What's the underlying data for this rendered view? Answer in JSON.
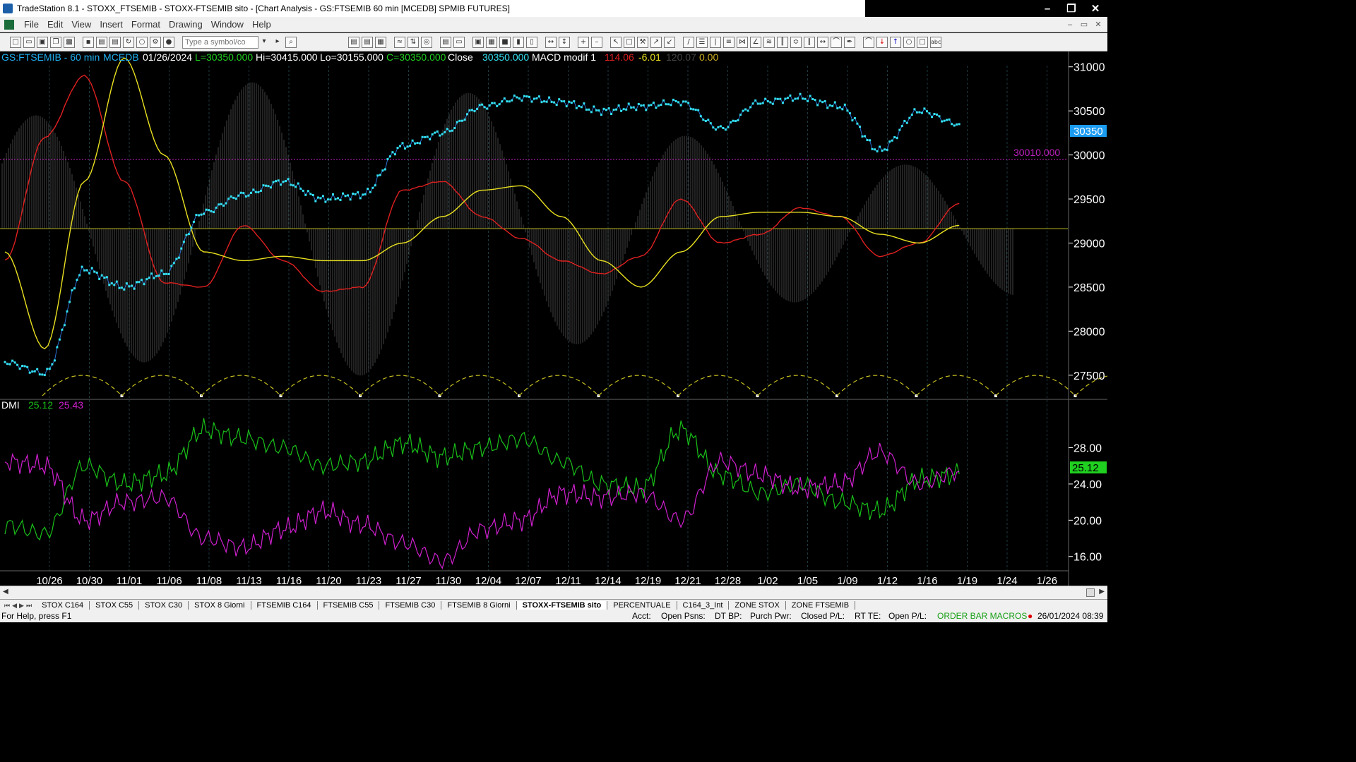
{
  "window": {
    "title": "TradeStation 8.1 - STOXX_FTSEMIB - STOXX-FTSEMIB sito - [Chart Analysis - GS:FTSEMIB  60 min  [MCEDB] SPMIB FUTURES]"
  },
  "menu": [
    "File",
    "Edit",
    "View",
    "Insert",
    "Format",
    "Drawing",
    "Window",
    "Help"
  ],
  "toolbar": {
    "symbol_placeholder": "Type a symbol/co"
  },
  "price_header": {
    "symbol": "GS:FTSEMIB - 60 min",
    "source": "MCEDB",
    "date": "01/26/2024",
    "last": "L=30350.000",
    "high": "Hi=30415.000",
    "low": "Lo=30155.000",
    "close": "C=30350.000",
    "close_label": "Close",
    "close_value": "30350.000",
    "indicator": "MACD modif 1",
    "ind_v1": "114.06",
    "ind_v2": "-6.01",
    "ind_v3": "120.07",
    "ind_v4": "0.00"
  },
  "price_axis": {
    "ticks": [
      "31000",
      "30500",
      "30000",
      "29500",
      "29000",
      "28500",
      "28000",
      "27500"
    ],
    "current_price": "30350",
    "reference_level": "30010.000"
  },
  "dmi_header": {
    "name": "DMI",
    "plus": "25.12",
    "minus": "25.43"
  },
  "dmi_axis": {
    "ticks": [
      "28.00",
      "24.00",
      "20.00",
      "16.00"
    ],
    "current": "25.12"
  },
  "time_axis": [
    "10/26",
    "10/30",
    "11/01",
    "11/06",
    "11/08",
    "11/13",
    "11/16",
    "11/20",
    "11/23",
    "11/27",
    "11/30",
    "12/04",
    "12/07",
    "12/11",
    "12/14",
    "12/19",
    "12/21",
    "12/28",
    "1/02",
    "1/05",
    "1/09",
    "1/12",
    "1/16",
    "1/19",
    "1/24",
    "1/26"
  ],
  "colors": {
    "price": "#33e0f0",
    "red_line": "#e02020",
    "yellow_line": "#e8e020",
    "histogram": "#7a7a7a",
    "dmi_plus": "#19c019",
    "dmi_minus": "#d020d0",
    "ref_level": "#c020c0"
  },
  "chart_data": [
    {
      "type": "line",
      "x": [
        "10/26",
        "10/30",
        "11/01",
        "11/06",
        "11/08",
        "11/13",
        "11/16",
        "11/20",
        "11/23",
        "11/27",
        "11/30",
        "12/04",
        "12/07",
        "12/11",
        "12/14",
        "12/19",
        "12/21",
        "12/28",
        "1/02",
        "1/05",
        "1/09",
        "1/12",
        "1/16",
        "1/19",
        "1/24"
      ],
      "ylim": [
        27250,
        31150
      ],
      "series": [
        {
          "values": [
            27650,
            27520,
            28700,
            28500,
            28650,
            29350,
            29550,
            29700,
            29500,
            29550,
            30100,
            30250,
            30550,
            30650,
            30600,
            30500,
            30550,
            30600,
            30300,
            30600,
            30650,
            30550,
            30050,
            30500,
            30350
          ]
        },
        {
          "values": [
            28800,
            30200,
            30900,
            29700,
            28550,
            28500,
            29200,
            28800,
            28450,
            28500,
            29600,
            29700,
            29300,
            29050,
            28800,
            28650,
            28850,
            29500,
            29000,
            29100,
            29400,
            29300,
            28850,
            29000,
            29450
          ]
        },
        {
          "values": [
            28900,
            27800,
            29700,
            31100,
            30000,
            28900,
            28800,
            28850,
            28800,
            28800,
            29000,
            29300,
            29600,
            29650,
            29300,
            28800,
            28500,
            28900,
            29300,
            29350,
            29350,
            29300,
            29100,
            29000,
            29200
          ]
        }
      ]
    },
    {
      "type": "line",
      "x": [
        "10/26",
        "10/30",
        "11/01",
        "11/06",
        "11/08",
        "11/13",
        "11/16",
        "11/20",
        "11/23",
        "11/27",
        "11/30",
        "12/04",
        "12/07",
        "12/11",
        "12/14",
        "12/19",
        "12/21",
        "12/28",
        "1/02",
        "1/05",
        "1/09",
        "1/12",
        "1/16",
        "1/19",
        "1/24"
      ],
      "ylim": [
        14.5,
        31
      ],
      "series": [
        {
          "name": "DMI+",
          "values": [
            19.5,
            18.5,
            26.0,
            24.0,
            25.0,
            30.0,
            29.0,
            28.0,
            26.0,
            26.5,
            28.5,
            27.0,
            28.0,
            29.0,
            26.5,
            24.0,
            23.5,
            30.0,
            25.0,
            23.0,
            24.0,
            22.0,
            21.0,
            24.5,
            25.1
          ]
        },
        {
          "name": "DMI-",
          "values": [
            26.5,
            26.0,
            20.0,
            22.0,
            22.5,
            18.0,
            17.0,
            19.0,
            21.0,
            19.5,
            17.5,
            15.5,
            19.0,
            20.0,
            23.0,
            22.5,
            23.0,
            20.0,
            26.5,
            25.0,
            23.5,
            24.0,
            27.5,
            24.0,
            25.4
          ]
        }
      ]
    }
  ],
  "tabs": [
    "STOX C164",
    "STOX C55",
    "STOX  C30",
    "STOX  8 Giorni",
    "FTSEMIB C164",
    "FTSEMIB C55",
    "FTSEMIB C30",
    "FTSEMIB  8 Giorni",
    "STOXX-FTSEMIB sito",
    "PERCENTUALE",
    "C164_3_Int",
    "ZONE STOX",
    "ZONE FTSEMIB"
  ],
  "active_tab": "STOXX-FTSEMIB sito",
  "status": {
    "help": "For Help, press F1",
    "acct": "Acct:",
    "open_psns": "Open Psns:",
    "dt_bp": "DT BP:",
    "purch_pwr": "Purch Pwr:",
    "closed_pl": "Closed P/L:",
    "rt_te": "RT TE:",
    "open_pl": "Open P/L:",
    "macros": "ORDER BAR  MACROS",
    "datetime": "26/01/2024 08:39"
  }
}
